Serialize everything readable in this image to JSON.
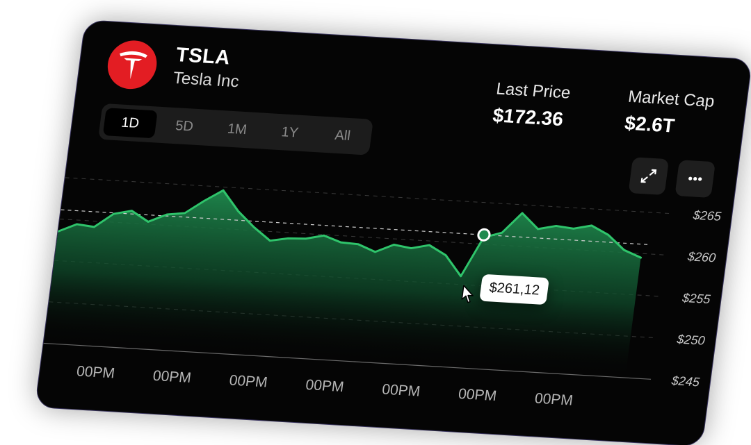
{
  "stock": {
    "ticker": "TSLA",
    "company": "Tesla Inc",
    "logo_icon": "tesla-logo-icon",
    "logo_color": "#e31d23"
  },
  "stats": {
    "last_price_label": "Last Price",
    "last_price_value": "$172.36",
    "market_cap_label": "Market Cap",
    "market_cap_value": "$2.6T"
  },
  "tabs": [
    {
      "label": "1D",
      "active": true
    },
    {
      "label": "5D",
      "active": false
    },
    {
      "label": "1M",
      "active": false
    },
    {
      "label": "1Y",
      "active": false
    },
    {
      "label": "All",
      "active": false
    }
  ],
  "actions": {
    "expand_icon": "expand-icon",
    "more_icon": "more-icon"
  },
  "tooltip": {
    "value": "$261,12"
  },
  "colors": {
    "accent": "#2fc46b",
    "background": "#050505"
  },
  "chart_data": {
    "type": "area",
    "y_ticks": [
      "$265",
      "$260",
      "$255",
      "$250",
      "$245"
    ],
    "x_ticks": [
      "00PM",
      "00PM",
      "00PM",
      "00PM",
      "00PM",
      "00PM",
      "00PM"
    ],
    "ylim": [
      245,
      267
    ],
    "reference_line": 261.12,
    "highlight_index": 24,
    "grid": true,
    "values": [
      258.5,
      259.5,
      259.3,
      261.0,
      261.5,
      260.3,
      261.3,
      261.6,
      263.2,
      264.6,
      262.2,
      260.4,
      258.9,
      259.3,
      259.4,
      259.9,
      259.2,
      259.1,
      258.3,
      259.3,
      259.0,
      259.5,
      258.4,
      256.0,
      260.8,
      261.5,
      264.0,
      262.2,
      262.7,
      262.5,
      263.0,
      262.0,
      260.3,
      259.5
    ]
  }
}
